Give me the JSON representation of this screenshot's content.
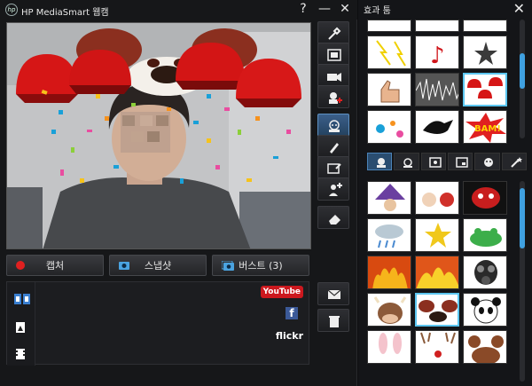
{
  "app": {
    "logo_text": "hp",
    "title": "HP MediaSmart 웹캠",
    "help_label": "?",
    "minimize_label": "—",
    "close_label": "✕"
  },
  "buttons": {
    "capture": "캡처",
    "snapshot": "스냅샷",
    "burst": "버스트 (3)"
  },
  "share": {
    "youtube": "YouTube",
    "facebook": "f",
    "flickr": "flickr"
  },
  "effects_panel": {
    "title": "효과 툼",
    "close_label": "✕"
  },
  "icons": {
    "side_toolbar": [
      "tools-icon",
      "frame-icon",
      "camera-video-icon",
      "avatar-add-icon",
      "avatar-effect-icon",
      "pencil-icon",
      "frame-edit-icon",
      "person-add-icon",
      "eraser-icon",
      "envelope-icon",
      "trash-icon"
    ],
    "tabs": [
      "avatar-tab-icon",
      "effect-tab-icon",
      "frame-tab-icon",
      "screen-tab-icon",
      "smiley-tab-icon",
      "magic-tab-icon"
    ]
  },
  "colors": {
    "accent": "#3fa0e0",
    "record_dot": "#e02020",
    "youtube_red": "#cc181e",
    "facebook_blue": "#3b5998"
  },
  "scroll": {
    "top_grid": 0.4,
    "bottom_grid": 0.05
  }
}
